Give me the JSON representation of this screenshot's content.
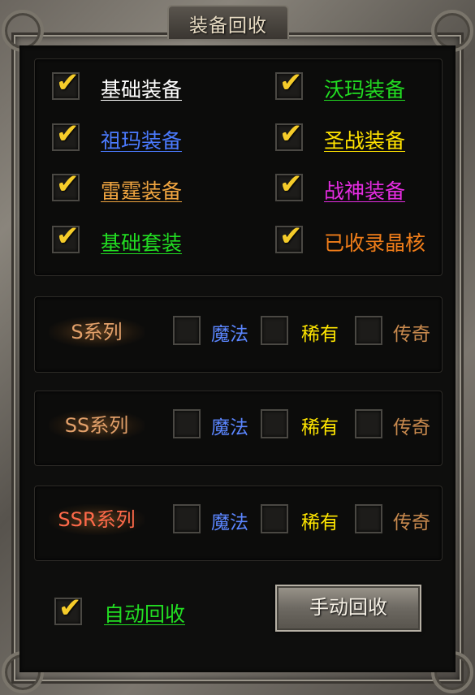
{
  "window": {
    "title": "装备回收"
  },
  "equipment": {
    "items": [
      {
        "label": "基础装备",
        "color": "#ffffff",
        "checked": true
      },
      {
        "label": "沃玛装备",
        "color": "#22dd22",
        "checked": true
      },
      {
        "label": "祖玛装备",
        "color": "#4b7bff",
        "checked": true
      },
      {
        "label": "圣战装备",
        "color": "#ffe200",
        "checked": true
      },
      {
        "label": "雷霆装备",
        "color": "#f0a540",
        "checked": true
      },
      {
        "label": "战神装备",
        "color": "#e42ce0",
        "checked": true
      },
      {
        "label": "基础套装",
        "color": "#22dd22",
        "checked": true
      },
      {
        "label": "已收录晶核",
        "color": "#f07d19",
        "checked": true
      }
    ]
  },
  "series": [
    {
      "name": "S系列",
      "options": [
        "魔法",
        "稀有",
        "传奇"
      ],
      "checked": [
        false,
        false,
        false
      ]
    },
    {
      "name": "SS系列",
      "options": [
        "魔法",
        "稀有",
        "传奇"
      ],
      "checked": [
        false,
        false,
        false
      ]
    },
    {
      "name": "SSR系列",
      "options": [
        "魔法",
        "稀有",
        "传奇"
      ],
      "checked": [
        false,
        false,
        false
      ]
    }
  ],
  "rarity_colors": {
    "魔法": "#5b86ff",
    "稀有": "#ffe600",
    "传奇": "#c98a4e"
  },
  "series_color": "#e2a06a",
  "auto_recycle": {
    "label": "自动回收",
    "checked": true,
    "color": "#22dd22"
  },
  "manual_button": {
    "label": "手动回收"
  },
  "icons": {
    "check": "checkmark-icon"
  }
}
